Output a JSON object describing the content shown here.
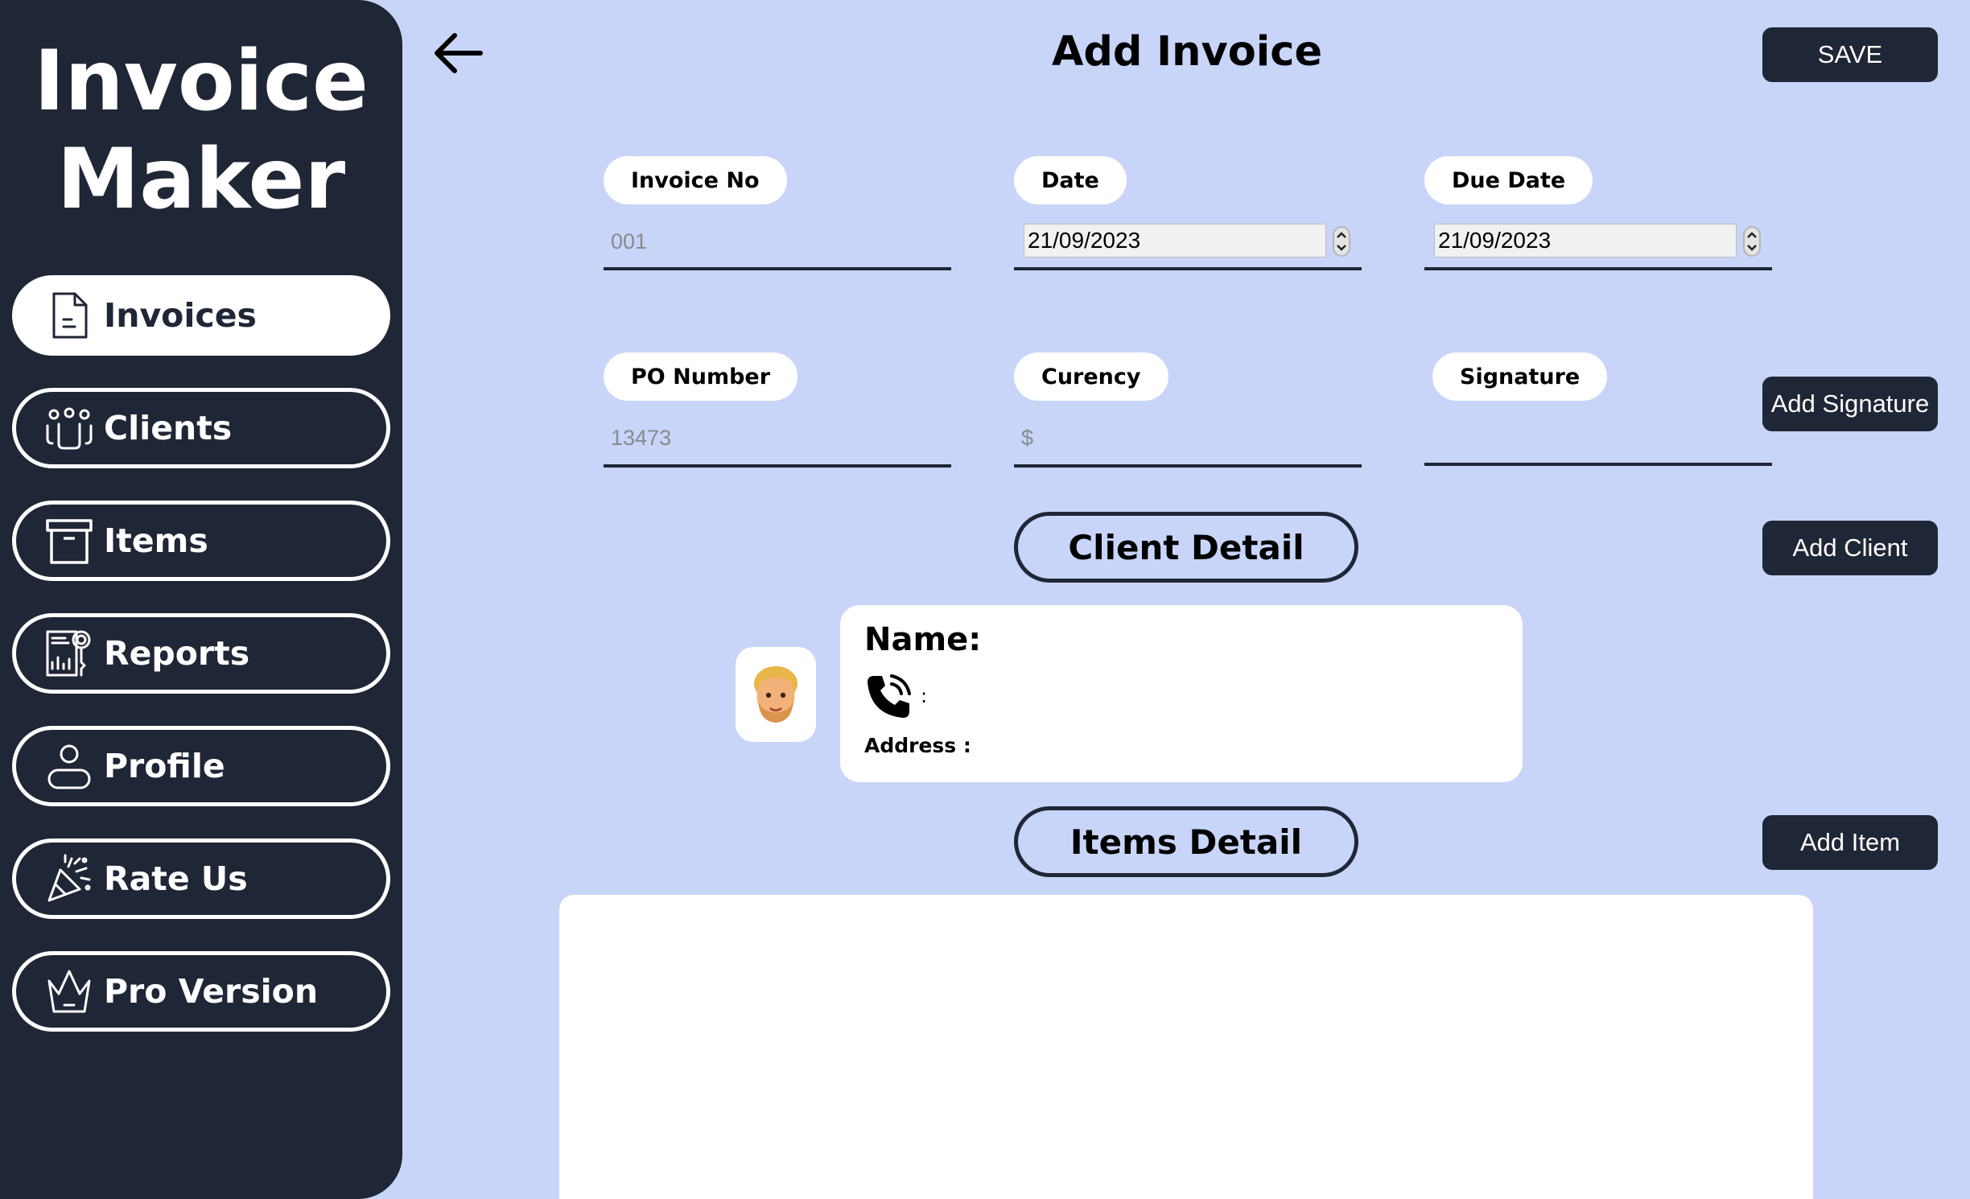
{
  "sidebar": {
    "brand_line1": "Invoice",
    "brand_line2": "Maker",
    "items": [
      {
        "label": "Invoices",
        "icon": "document-icon",
        "active": true
      },
      {
        "label": "Clients",
        "icon": "users-icon",
        "active": false
      },
      {
        "label": "Items",
        "icon": "archive-box-icon",
        "active": false
      },
      {
        "label": "Reports",
        "icon": "report-icon",
        "active": false
      },
      {
        "label": "Profile",
        "icon": "user-icon",
        "active": false
      },
      {
        "label": "Rate Us",
        "icon": "party-popper-icon",
        "active": false
      },
      {
        "label": "Pro Version",
        "icon": "crown-icon",
        "active": false
      }
    ]
  },
  "header": {
    "title": "Add Invoice",
    "save_label": "SAVE"
  },
  "form": {
    "invoice_no": {
      "label": "Invoice No",
      "value": "001"
    },
    "date": {
      "label": "Date",
      "value": "21/09/2023"
    },
    "due_date": {
      "label": "Due Date",
      "value": "21/09/2023"
    },
    "po_number": {
      "label": "PO Number",
      "value": "13473"
    },
    "currency": {
      "label": "Curency",
      "value": "$"
    },
    "signature": {
      "label": "Signature",
      "value": ""
    },
    "add_signature_label": "Add Signature"
  },
  "client": {
    "section_title": "Client Detail",
    "add_label": "Add Client",
    "name_label": "Name:",
    "phone_sep": ":",
    "address_label": "Address :"
  },
  "items": {
    "section_title": "Items Detail",
    "add_label": "Add Item"
  },
  "colors": {
    "background": "#c8d5f9",
    "sidebar": "#1f2635",
    "button": "#1f2635",
    "card": "#ffffff"
  }
}
